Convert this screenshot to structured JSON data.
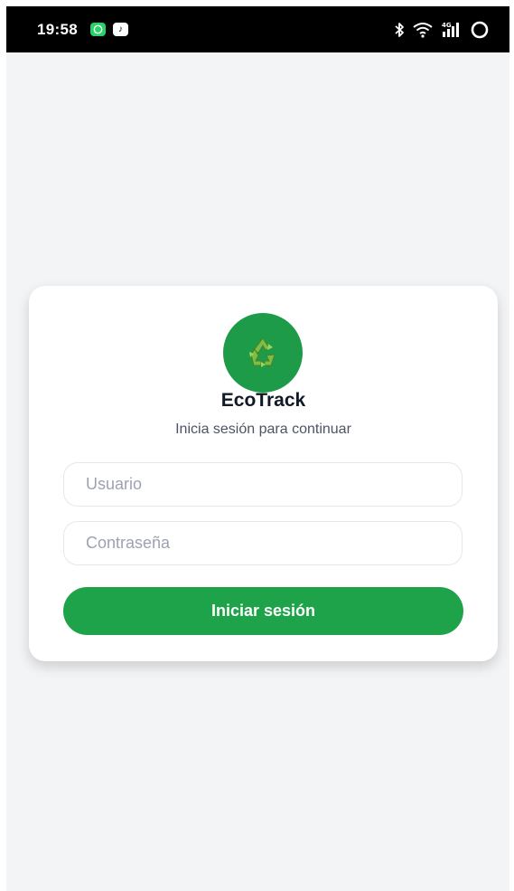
{
  "status_bar": {
    "time": "19:58",
    "notification_icons": [
      "whatsapp-icon",
      "tiktok-icon"
    ],
    "system_icons": [
      "bluetooth-icon",
      "wifi-icon",
      "signal-4g-icon",
      "battery-ring-icon"
    ],
    "network_label": "4G"
  },
  "login": {
    "logo_icon": "recycle-icon",
    "title": "EcoTrack",
    "subtitle": "Inicia sesión para continuar",
    "username_placeholder": "Usuario",
    "password_placeholder": "Contraseña",
    "submit_label": "Iniciar sesión"
  },
  "colors": {
    "status_bar_bg": "#000000",
    "screen_bg": "#f3f4f6",
    "card_bg": "#ffffff",
    "brand_green": "#1ea34a",
    "logo_green": "#1d9b48",
    "title_text": "#111827",
    "subtitle_text": "#4b5563",
    "placeholder_text": "#9ca3af"
  }
}
